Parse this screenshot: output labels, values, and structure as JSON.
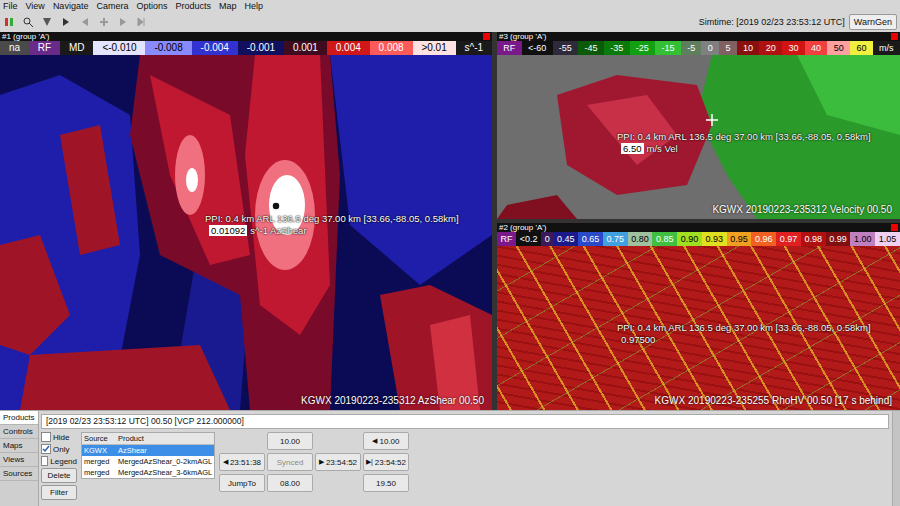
{
  "menu": [
    "File",
    "View",
    "Navigate",
    "Camera",
    "Options",
    "Products",
    "Map",
    "Help"
  ],
  "toolbar": {
    "simtime": "Simtime: [2019 02/23 23:53:12 UTC]",
    "warngen": "WarnGen"
  },
  "panes": [
    {
      "title": "#1 (group 'A')",
      "kind": "azshear",
      "segments": [
        {
          "label": "na",
          "color": "#4a4a4a"
        },
        {
          "label": "RF",
          "color": "#6a2a8a"
        },
        {
          "label": "MD",
          "color": "#1a1a1a"
        },
        {
          "label": "<-0.010",
          "color": "#e4e4ff"
        },
        {
          "label": "-0.008",
          "color": "#8a8aff"
        },
        {
          "label": "-0.004",
          "color": "#3232d0"
        },
        {
          "label": "-0.001",
          "color": "#10105e"
        },
        {
          "label": "0.001",
          "color": "#3e0c1e"
        },
        {
          "label": "0.004",
          "color": "#d01818"
        },
        {
          "label": "0.008",
          "color": "#ff5a5a"
        },
        {
          "label": ">0.01",
          "color": "#ffe2e2"
        },
        {
          "label": "s^-1",
          "color": "#1a1a1a"
        }
      ],
      "readout": {
        "text": "PPI: 0.4 km ARL 136.5 deg 37.00 km [33.66,-88.05, 0.58km]",
        "value": "0.01092",
        "unit": "s^-1 AzShear",
        "boxed": true
      },
      "footer": "KGWX 20190223-235312 AzShear 00.50"
    },
    {
      "title": "#3 (group 'A')",
      "kind": "velocity",
      "segments": [
        {
          "label": "RF",
          "color": "#7a1a8a"
        },
        {
          "label": "<-60",
          "color": "#101010"
        },
        {
          "label": "-55",
          "color": "#2e2a3a"
        },
        {
          "label": "-45",
          "color": "#0a5a0a"
        },
        {
          "label": "-35",
          "color": "#0a7a0a"
        },
        {
          "label": "-25",
          "color": "#12a012"
        },
        {
          "label": "-15",
          "color": "#34c034"
        },
        {
          "label": "-5",
          "color": "#5e7e5e"
        },
        {
          "label": "0",
          "color": "#808080"
        },
        {
          "label": "5",
          "color": "#806060"
        },
        {
          "label": "10",
          "color": "#8a1010"
        },
        {
          "label": "20",
          "color": "#b01010"
        },
        {
          "label": "30",
          "color": "#d01414"
        },
        {
          "label": "40",
          "color": "#f04040"
        },
        {
          "label": "50",
          "color": "#ffa0a0"
        },
        {
          "label": "60",
          "color": "#f0f040"
        },
        {
          "label": "m/s",
          "color": "#1a1a1a"
        }
      ],
      "readout": {
        "text": "PPI: 0.4 km ARL 136.5 deg 37.00 km [33.66,-88.05, 0.58km]",
        "value": "6.50",
        "unit": "m/s Vel",
        "boxed": true
      },
      "footer": "KGWX 20190223-235312 Velocity 00.50"
    },
    {
      "title": "#2 (group 'A')",
      "kind": "rhohv",
      "segments": [
        {
          "label": "RF",
          "color": "#7a1a8a"
        },
        {
          "label": "<0.2",
          "color": "#101010"
        },
        {
          "label": "0",
          "color": "#3a1a5a"
        },
        {
          "label": "0.45",
          "color": "#1a1a8a"
        },
        {
          "label": "0.65",
          "color": "#2a4aca"
        },
        {
          "label": "0.75",
          "color": "#40a0e0"
        },
        {
          "label": "0.80",
          "color": "#a0c0a0"
        },
        {
          "label": "0.85",
          "color": "#40c040"
        },
        {
          "label": "0.90",
          "color": "#a0e020"
        },
        {
          "label": "0.93",
          "color": "#e0e020"
        },
        {
          "label": "0.95",
          "color": "#f0a020"
        },
        {
          "label": "0.96",
          "color": "#f06020"
        },
        {
          "label": "0.97",
          "color": "#e02020"
        },
        {
          "label": "0.98",
          "color": "#b01010"
        },
        {
          "label": "0.99",
          "color": "#801010"
        },
        {
          "label": "1.00",
          "color": "#c080c0"
        },
        {
          "label": "1.05",
          "color": "#f0d0f0"
        }
      ],
      "readout": {
        "text": "PPI: 0.4 km ARL 136.5 deg 37.00 km [33.66,-88.05, 0.58km]",
        "value": "0.97500",
        "unit": "",
        "boxed": false
      },
      "footer": "KGWX 20190223-235255 RhoHV 00.50 [17 s behind]"
    }
  ],
  "bottom": {
    "side_tabs": [
      {
        "label": "Products",
        "selected": true
      },
      {
        "label": "Controls",
        "selected": false
      },
      {
        "label": "Maps",
        "selected": false
      },
      {
        "label": "Views",
        "selected": false
      },
      {
        "label": "Sources",
        "selected": false
      }
    ],
    "info": "[2019 02/23 23:53:12 UTC] 00.50 [VCP 212.000000]",
    "options": [
      {
        "label": "Hide",
        "checked": false
      },
      {
        "label": "Only",
        "checked": true
      },
      {
        "label": "Legend",
        "checked": false
      }
    ],
    "actions": [
      "Delete",
      "Filter"
    ],
    "table": {
      "columns": [
        "Source",
        "Product"
      ],
      "rows": [
        {
          "source": "KGWX",
          "product": "AzShear",
          "selected": true
        },
        {
          "source": "merged",
          "product": "MergedAzShear_0-2kmAGL",
          "selected": false
        },
        {
          "source": "merged",
          "product": "MergedAzShear_3-6kmAGL",
          "selected": false
        }
      ]
    },
    "time_controls": [
      [
        {
          "kind": "empty"
        },
        {
          "kind": "button",
          "label": "10.00",
          "disabled": false
        },
        {
          "kind": "empty"
        },
        {
          "kind": "button",
          "icon": "◀",
          "label": "10.00",
          "disabled": false
        }
      ],
      [
        {
          "kind": "button",
          "icon": "◀",
          "label": "23:51:38",
          "disabled": false
        },
        {
          "kind": "button",
          "label": "Synced",
          "disabled": true
        },
        {
          "kind": "button",
          "icon": "▶",
          "label": "23:54:52",
          "disabled": false
        },
        {
          "kind": "button",
          "icon": "▶|",
          "label": "23:54:52",
          "disabled": false
        }
      ],
      [
        {
          "kind": "button",
          "label": "JumpTo",
          "disabled": false
        },
        {
          "kind": "button",
          "label": "08.00",
          "disabled": false
        },
        {
          "kind": "empty"
        },
        {
          "kind": "button",
          "label": "19.50",
          "disabled": false
        }
      ]
    ]
  }
}
